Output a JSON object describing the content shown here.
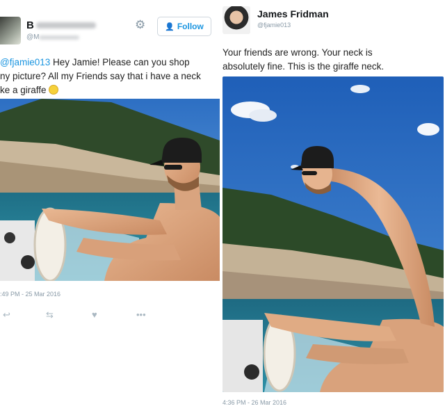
{
  "left_tweet": {
    "name": "B",
    "handle": "@M",
    "follow_label": "Follow",
    "text_mention": "@fjamie013",
    "text_line1_rest": " Hey Jamie! Please can you shop",
    "text_line2": "ny picture? All my Friends say that i have a neck",
    "text_line3": "ke a giraffe",
    "timestamp": ":49 PM - 25 Mar 2016",
    "icons": [
      "reply-icon",
      "retweet-icon",
      "like-icon",
      "more-icon"
    ]
  },
  "right_tweet": {
    "name": "James Fridman",
    "handle": "@fjamie013",
    "text_line1": "Your friends are wrong. Your neck is",
    "text_line2": "absolutely fine. This is the giraffe neck.",
    "timestamp": "4:36 PM - 26 Mar 2016"
  },
  "colors": {
    "link_blue": "#1b95e0",
    "muted_gray": "#8899a6",
    "sky_blue": "#2f78c8"
  }
}
